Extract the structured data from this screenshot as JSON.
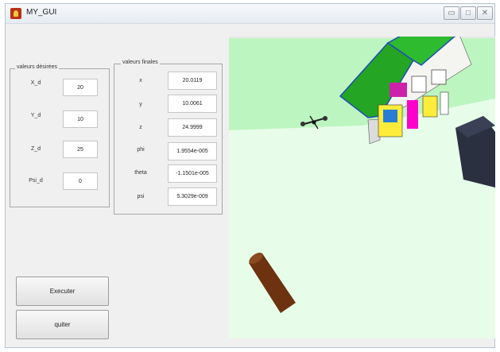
{
  "window": {
    "title": "MY_GUI",
    "min_icon": "minimize-icon",
    "max_icon": "maximize-icon",
    "close_icon": "close-icon",
    "min_glyph": "▭",
    "max_glyph": "□",
    "close_glyph": "✕"
  },
  "desired": {
    "title": "valeurs désirées",
    "rows": [
      {
        "label": "X_d",
        "value": "20"
      },
      {
        "label": "Y_d",
        "value": "10"
      },
      {
        "label": "Z_d",
        "value": "25"
      },
      {
        "label": "Psi_d",
        "value": "0"
      }
    ]
  },
  "final": {
    "title": "valeurs finales",
    "rows": [
      {
        "label": "x",
        "value": "20.0119"
      },
      {
        "label": "y",
        "value": "10.0061"
      },
      {
        "label": "z",
        "value": "24.9999"
      },
      {
        "label": "phi",
        "value": "1.9554e-005"
      },
      {
        "label": "theta",
        "value": "-1.1501e-005"
      },
      {
        "label": "psi",
        "value": "5.3029e-009"
      }
    ]
  },
  "buttons": {
    "execute": "Executer",
    "quit": "quiter"
  },
  "colors": {
    "sky": "#ffffff",
    "ground_far": "#bdf5c0",
    "ground_near": "#e7fde9",
    "roof": "#1fa51f",
    "house_wall": "#f4f4f0",
    "cube": "#2b3040",
    "log": "#6d3210"
  }
}
